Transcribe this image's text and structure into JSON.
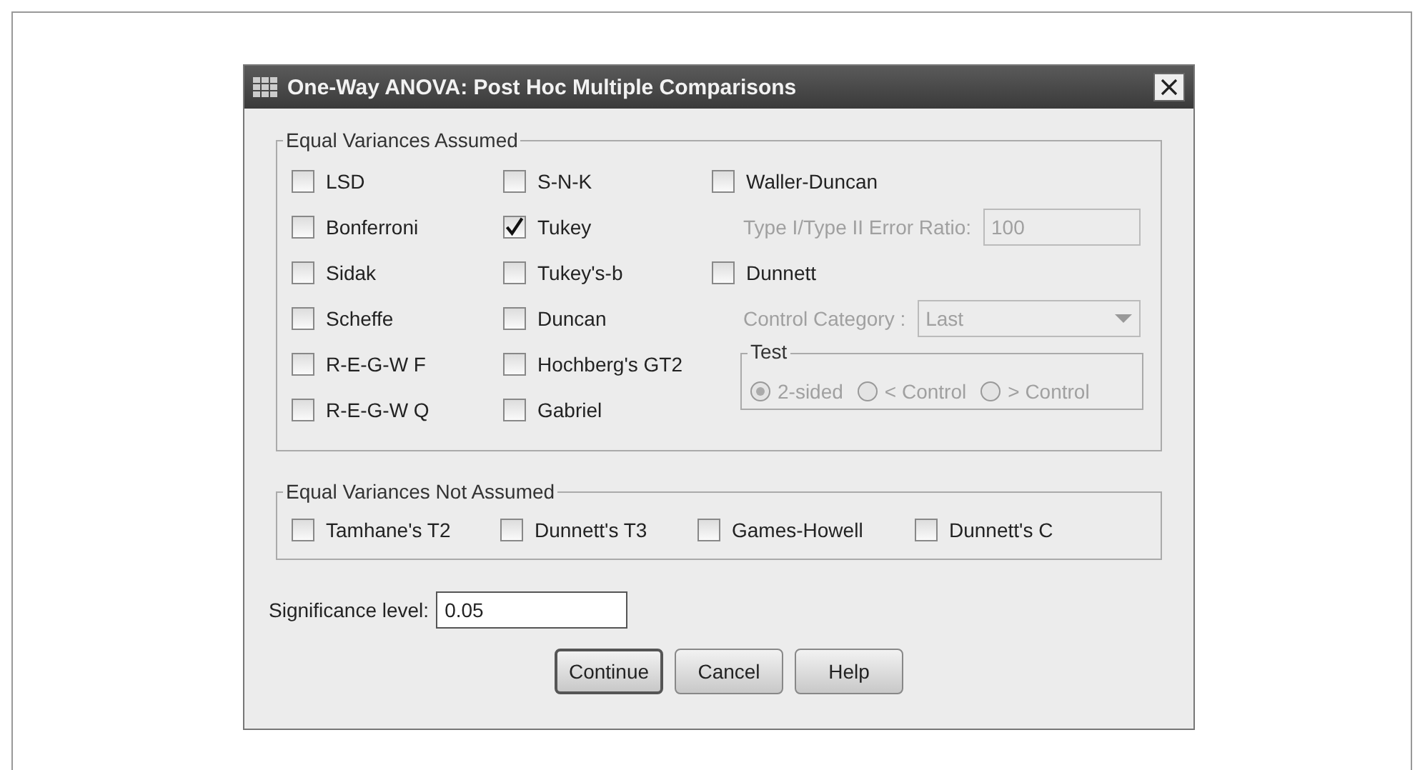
{
  "window": {
    "title": "One-Way ANOVA: Post Hoc Multiple Comparisons"
  },
  "assumed": {
    "legend": "Equal Variances Assumed",
    "columns": [
      [
        {
          "label": "LSD",
          "checked": false
        },
        {
          "label": "Bonferroni",
          "checked": false
        },
        {
          "label": "Sidak",
          "checked": false
        },
        {
          "label": "Scheffe",
          "checked": false
        },
        {
          "label": "R-E-G-W F",
          "checked": false
        },
        {
          "label": "R-E-G-W Q",
          "checked": false
        }
      ],
      [
        {
          "label": "S-N-K",
          "checked": false
        },
        {
          "label": "Tukey",
          "checked": true
        },
        {
          "label": "Tukey's-b",
          "checked": false
        },
        {
          "label": "Duncan",
          "checked": false
        },
        {
          "label": "Hochberg's GT2",
          "checked": false
        },
        {
          "label": "Gabriel",
          "checked": false
        }
      ]
    ],
    "extras": [
      {
        "kind": "checkbox",
        "label": "Waller-Duncan",
        "checked": false
      },
      {
        "kind": "field",
        "label": "Type I/Type II Error Ratio:",
        "value": "100",
        "disabled": true
      },
      {
        "kind": "checkbox",
        "label": "Dunnett",
        "checked": false
      },
      {
        "kind": "dropdown",
        "label": "Control Category :",
        "value": "Last",
        "disabled": true
      },
      {
        "kind": "radios",
        "legend": "Test",
        "disabled": true,
        "options": [
          {
            "label": "2-sided",
            "selected": true
          },
          {
            "label": "< Control",
            "selected": false
          },
          {
            "label": "> Control",
            "selected": false
          }
        ]
      }
    ]
  },
  "not_assumed": {
    "legend": "Equal Variances Not Assumed",
    "options": [
      {
        "label": "Tamhane's T2",
        "checked": false
      },
      {
        "label": "Dunnett's T3",
        "checked": false
      },
      {
        "label": "Games-Howell",
        "checked": false
      },
      {
        "label": "Dunnett's C",
        "checked": false
      }
    ]
  },
  "significance": {
    "label": "Significance level:",
    "value": "0.05"
  },
  "buttons": [
    {
      "label": "Continue",
      "default": true
    },
    {
      "label": "Cancel",
      "default": false
    },
    {
      "label": "Help",
      "default": false
    }
  ]
}
